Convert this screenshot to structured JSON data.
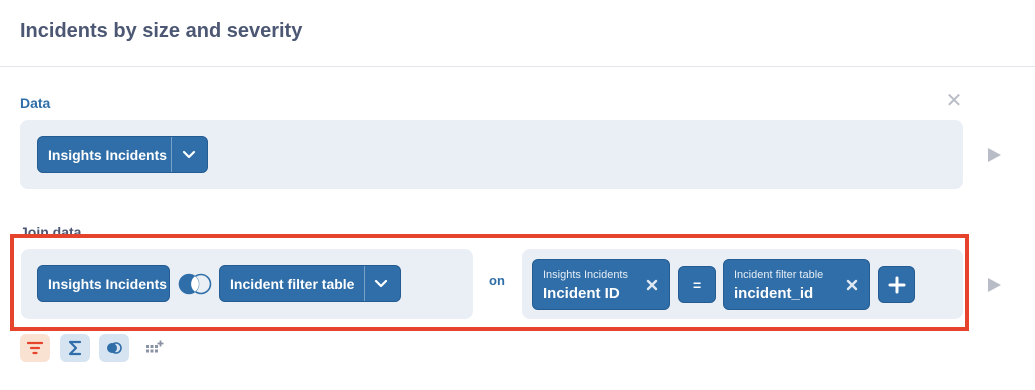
{
  "header": {
    "title": "Incidents by size and severity"
  },
  "data_section": {
    "label": "Data",
    "table_name": "Insights Incidents",
    "close_icon": "close-icon",
    "chevron_icon": "chevron-down-icon",
    "run_icon": "play-icon"
  },
  "join_section": {
    "label": "Join data",
    "left_table": "Insights Incidents",
    "join_type_icon": "venn-left-join-icon",
    "right_table": "Incident filter table",
    "on_label": "on",
    "left_column": {
      "table": "Insights Incidents",
      "column": "Incident ID"
    },
    "operator": "=",
    "right_column": {
      "table": "Incident filter table",
      "column": "incident_id"
    },
    "add_icon": "plus-icon",
    "run_icon": "play-icon"
  },
  "toolbar": {
    "items": [
      {
        "icon": "filter-icon",
        "bg": "#f9e2d2",
        "color": "#e5432b"
      },
      {
        "icon": "sum-icon",
        "bg": "#d6e4f2",
        "color": "#2f6ea8"
      },
      {
        "icon": "join-icon",
        "bg": "#d6e4f2",
        "color": "#2f6ea8"
      },
      {
        "icon": "custom-column-icon",
        "bg": "#ffffff",
        "color": "#8a93a6"
      }
    ]
  },
  "colors": {
    "accent": "#2f6ea8",
    "highlight": "#e5432b",
    "panel_bg": "#eaeff6"
  }
}
